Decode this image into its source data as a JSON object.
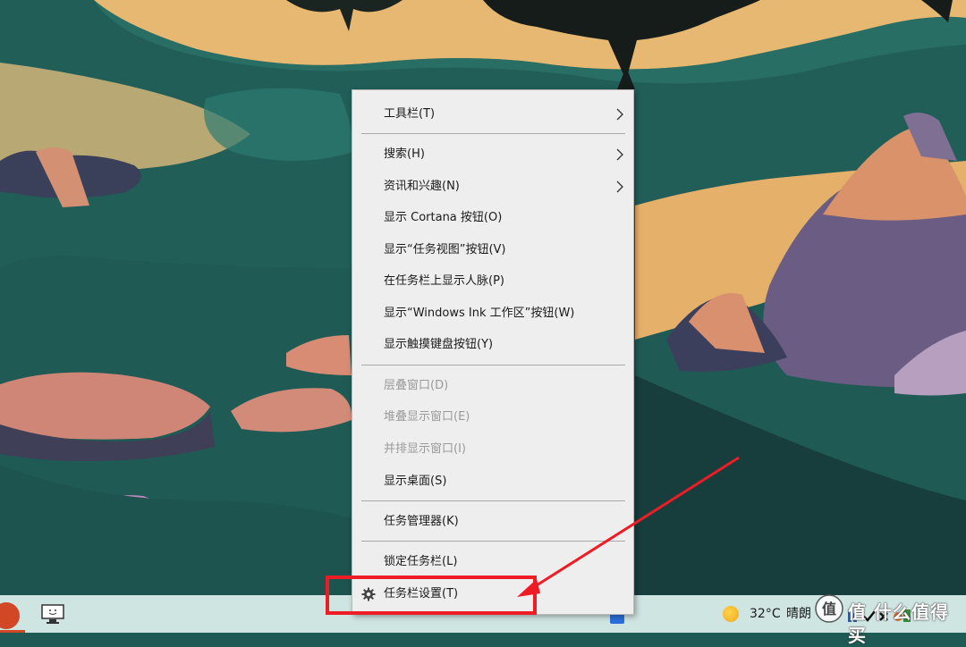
{
  "context_menu": {
    "items": [
      {
        "label": "工具栏(T)",
        "submenu": true,
        "enabled": true
      },
      {
        "label": "搜索(H)",
        "submenu": true,
        "enabled": true
      },
      {
        "label": "资讯和兴趣(N)",
        "submenu": true,
        "enabled": true
      },
      {
        "label": "显示 Cortana 按钮(O)",
        "submenu": false,
        "enabled": true
      },
      {
        "label": "显示“任务视图”按钮(V)",
        "submenu": false,
        "enabled": true
      },
      {
        "label": "在任务栏上显示人脉(P)",
        "submenu": false,
        "enabled": true
      },
      {
        "label": "显示“Windows Ink 工作区”按钮(W)",
        "submenu": false,
        "enabled": true
      },
      {
        "label": "显示触摸键盘按钮(Y)",
        "submenu": false,
        "enabled": true
      },
      {
        "label": "层叠窗口(D)",
        "submenu": false,
        "enabled": false
      },
      {
        "label": "堆叠显示窗口(E)",
        "submenu": false,
        "enabled": false
      },
      {
        "label": "并排显示窗口(I)",
        "submenu": false,
        "enabled": false
      },
      {
        "label": "显示桌面(S)",
        "submenu": false,
        "enabled": true
      },
      {
        "label": "任务管理器(K)",
        "submenu": false,
        "enabled": true
      },
      {
        "label": "锁定任务栏(L)",
        "submenu": false,
        "enabled": true
      },
      {
        "label": "任务栏设置(T)",
        "submenu": false,
        "enabled": true,
        "icon": "gear-icon"
      }
    ]
  },
  "taskbar": {
    "weather": {
      "temperature": "32°C",
      "condition": "晴朗",
      "icon": "sun-icon"
    },
    "pinned_icons": [
      "powerpoint-icon",
      "monitor-icon"
    ]
  },
  "watermark": {
    "text": "值 什么值得买"
  },
  "annotation": {
    "color": "#ee1c24",
    "target": "任务栏设置(T)"
  },
  "colors": {
    "menu_bg": "#eeeeee",
    "disabled_text": "#9a9a9a",
    "taskbar_bg": "#cfe5e2"
  }
}
